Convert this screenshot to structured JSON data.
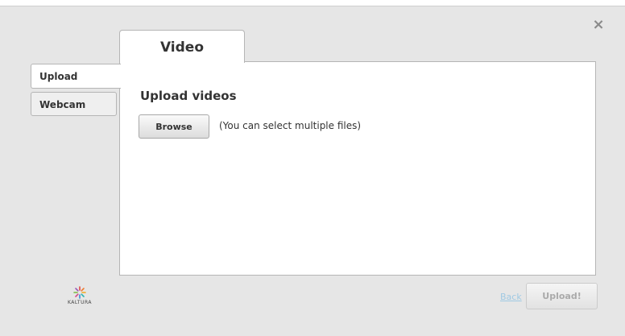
{
  "dialog": {
    "close_label": "×"
  },
  "main_tab": {
    "label": "Video"
  },
  "side_tabs": [
    {
      "label": "Upload",
      "active": true
    },
    {
      "label": "Webcam",
      "active": false
    }
  ],
  "upload_panel": {
    "title": "Upload videos",
    "browse_label": "Browse",
    "hint": "(You can select multiple files)"
  },
  "footer": {
    "logo_text": "KALTURA",
    "back_label": "Back",
    "upload_label": "Upload!"
  },
  "colors": {
    "link": "#9fc9e3",
    "disabled_text": "#aaaaaa"
  }
}
